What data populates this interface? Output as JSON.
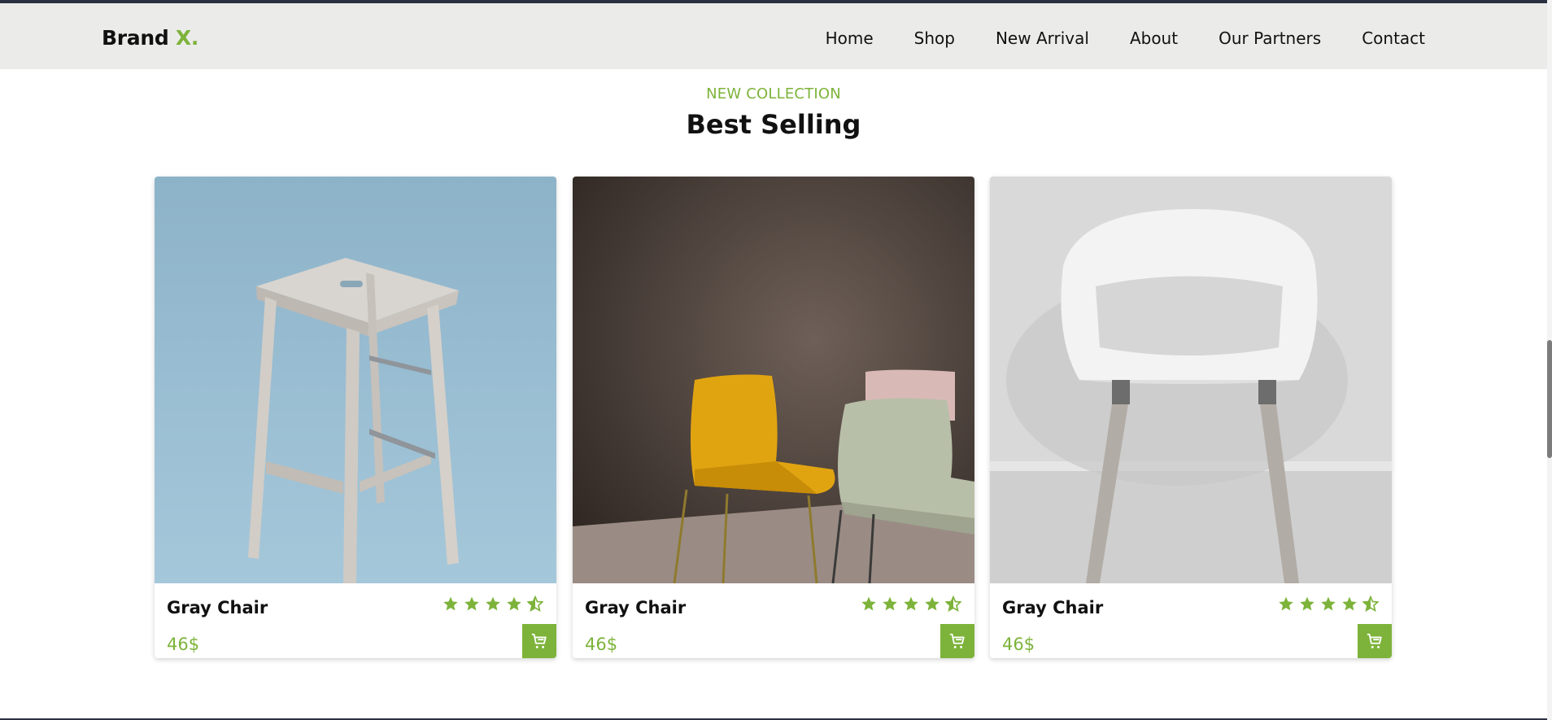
{
  "header": {
    "brand_text": "Brand",
    "brand_accent": "X.",
    "nav": [
      "Home",
      "Shop",
      "New Arrival",
      "About",
      "Our Partners",
      "Contact"
    ]
  },
  "section": {
    "eyebrow": "NEW COLLECTION",
    "title": "Best Selling"
  },
  "products": [
    {
      "name": "Gray Chair",
      "price": "46$",
      "rating": 4.5,
      "image": "wooden-stool-blue-background"
    },
    {
      "name": "Gray Chair",
      "price": "46$",
      "rating": 4.5,
      "image": "yellow-and-gray-chairs-brown-wall"
    },
    {
      "name": "Gray Chair",
      "price": "46$",
      "rating": 4.5,
      "image": "white-chair-gray-legs"
    }
  ],
  "icons": {
    "cart": "shopping-cart-icon",
    "star": "star-icon",
    "half_star": "half-star-icon"
  },
  "colors": {
    "accent": "#7db33a",
    "header_bg": "#ebebea",
    "text": "#111111"
  }
}
